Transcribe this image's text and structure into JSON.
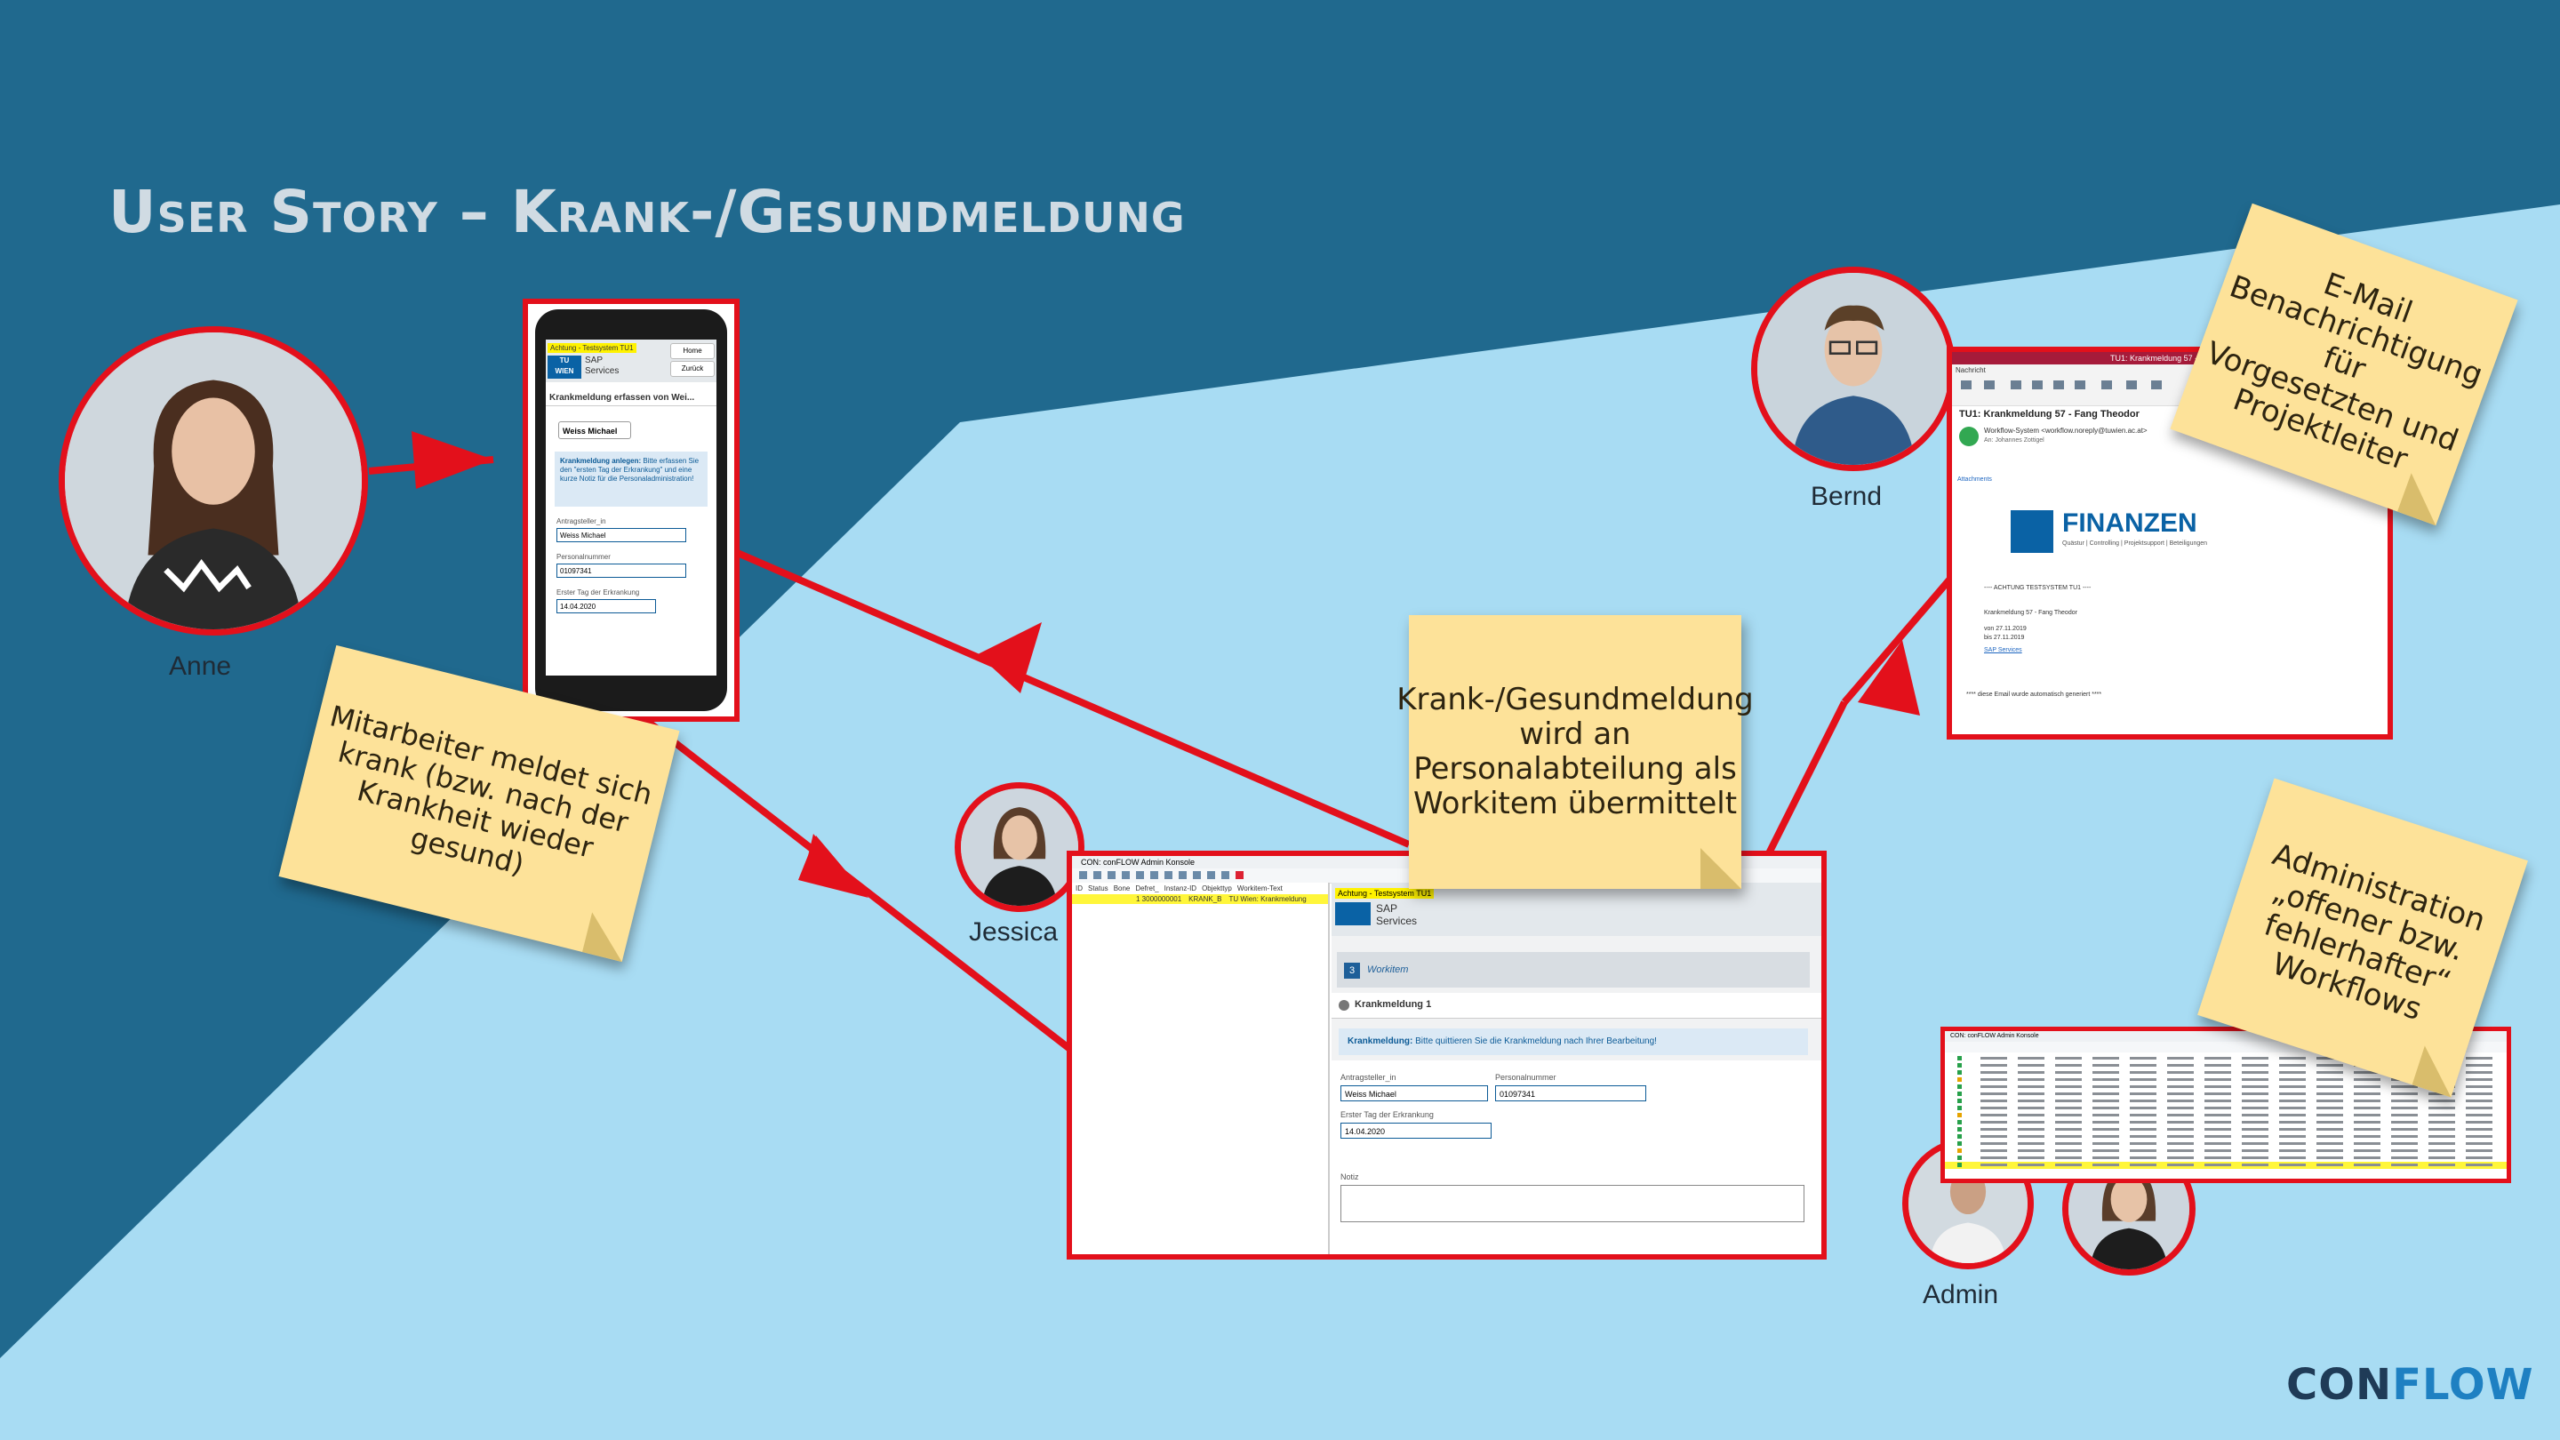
{
  "title": "User Story – Krank-/Gesundmeldung",
  "people": {
    "anne": "Anne",
    "bernd": "Bernd",
    "jessica": "Jessica",
    "admin": "Admin"
  },
  "notes": {
    "mitarbeiter": [
      "Mitarbeiter meldet sich",
      "krank (bzw. nach der",
      "Krankheit wieder gesund)"
    ],
    "workitem": [
      "Krank-/Gesundmeldung",
      "wird an",
      "Personalabteilung als",
      "Workitem übermittelt"
    ],
    "email": [
      "E-Mail",
      "Benachrichtigung für",
      "Vorgesetzten und",
      "Projektleiter"
    ],
    "administration": [
      "Administration",
      "„offener bzw.",
      "fehlerhafter“",
      "Workflows"
    ]
  },
  "phone": {
    "banner": "Achtung - Testsystem TU1",
    "home": "Home",
    "back": "Zurück",
    "sap": "SAP",
    "services": "Services",
    "tu": "TU",
    "wien": "WIEN",
    "header": "Krankmeldung erfassen von Wei...",
    "person_select": "Weiss Michael",
    "info_bold": "Krankmeldung anlegen:",
    "info_text": "Bitte erfassen Sie den \"ersten Tag der Erkrankung\" und eine kurze Notiz für die Personaladministration!",
    "field1_label": "Antragsteller_in",
    "field1_value": "Weiss Michael",
    "field2_label": "Personalnummer",
    "field2_value": "01097341",
    "field3_label": "Erster Tag der Erkrankung",
    "field3_value": "14.04.2020"
  },
  "console": {
    "window_title": "CON: conFLOW Admin Konsole",
    "columns": [
      "ID",
      "Status",
      "Bone",
      "Defret_",
      "Instanz-ID",
      "Objekttyp",
      "Workitem-Text"
    ],
    "row": [
      "",
      "",
      "",
      "",
      "1 3000000001",
      "KRANK_B",
      "TU Wien: Krankmeldung"
    ],
    "banner": "Achtung - Testsystem TU1",
    "sap": "SAP",
    "services": "Services",
    "workitem_num": "3",
    "workitem_label": "Workitem",
    "krank_title": "Krankmeldung 1",
    "info_bold": "Krankmeldung:",
    "info_text": "Bitte quittieren Sie die Krankmeldung nach Ihrer Bearbeitung!",
    "f1_label": "Antragsteller_in",
    "f1_value": "Weiss Michael",
    "f2_label": "Personalnummer",
    "f2_value": "01097341",
    "f3_label": "Erster Tag der Erkrankung",
    "f3_value": "14.04.2020",
    "notiz": "Notiz"
  },
  "email": {
    "window_title": "TU1: Krankmeldung 57 - Fang Th",
    "tab": "Nachricht",
    "subject": "TU1: Krankmeldung 57 - Fang Theodor",
    "from": "Workflow-System <workflow.noreply@tuwien.ac.at>",
    "to": "An: Johannes Zottigel",
    "attachments": "Attachments",
    "brand": "FINANZEN",
    "brand_sub": "Quästur | Controlling | Projektsupport | Beteiligungen",
    "warn": "---- ACHTUNG TESTSYSTEM TU1 ----",
    "line1": "Krankmeldung 57 - Fang Theodor",
    "line2": "von 27.11.2019",
    "line3": "bis 27.11.2019",
    "link": "SAP Services",
    "footer": "**** diese Email wurde automatisch generiert ****"
  },
  "admin_console": {
    "window_title": "CON: conFLOW Admin Konsole",
    "status_values": [
      "COMPLETED",
      "STARTED",
      "ERROR"
    ]
  },
  "logo": {
    "con": "CON",
    "flow": "FLOW"
  },
  "colors": {
    "dark_blue": "#20698e",
    "light_blue": "#a6dbf2",
    "red": "#e3101b",
    "note_yellow": "#fde299",
    "title_gray": "#d0dbe3"
  }
}
